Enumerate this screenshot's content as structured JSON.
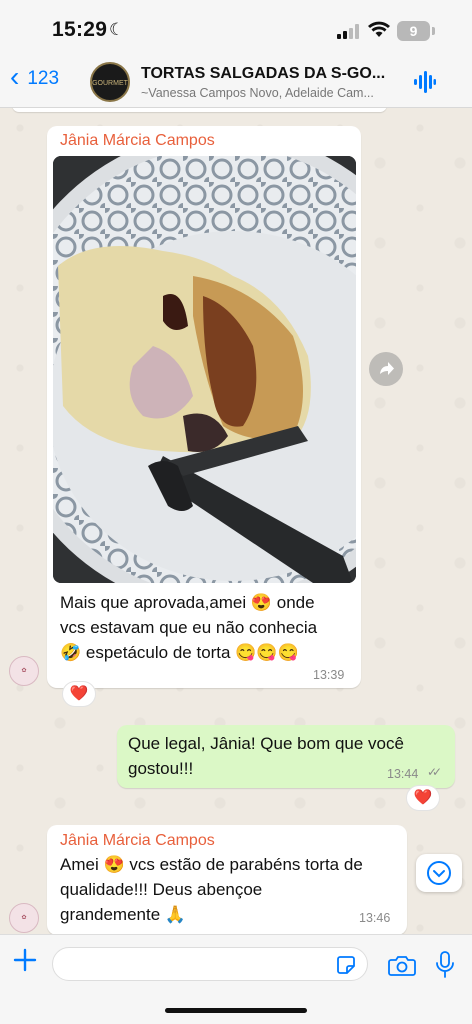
{
  "status_bar": {
    "time": "15:29",
    "battery": "9"
  },
  "header": {
    "back_count": "123",
    "title": "TORTAS SALGADAS DA S-GO...",
    "subtitle": "~Vanessa Campos Novo, Adelaide Cam...",
    "avatar_text": "GOURMET"
  },
  "messages": [
    {
      "sender": "Jânia Márcia Campos",
      "text_line1": "Mais que aprovada,amei 😍 onde",
      "text_line2": "vcs estavam que eu não conhecia",
      "text_line3": "🤣 espetáculo de torta 😋😋😋",
      "time": "13:39",
      "reaction": "❤️"
    },
    {
      "text_line1": "Que legal, Jânia! Que bom que você",
      "text_line2": "gostou!!!",
      "time": "13:44",
      "reaction": "❤️"
    },
    {
      "sender": "Jânia Márcia Campos",
      "text_line1": "Amei 😍 vcs estão de parabéns torta de",
      "text_line2": "qualidade!!! Deus abençoe",
      "text_line3": "grandemente 🙏",
      "time": "13:46"
    }
  ],
  "colors": {
    "accent": "#007aff",
    "sender": "#e8603c",
    "outgoing": "#dbf8c6"
  }
}
